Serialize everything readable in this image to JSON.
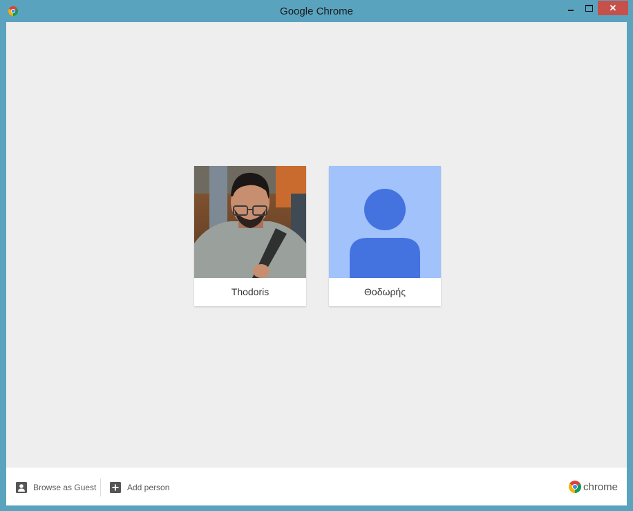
{
  "window": {
    "title": "Google Chrome",
    "close_glyph": "✕",
    "frame_color": "#5aa3bf",
    "close_color": "#c7504a"
  },
  "profiles": [
    {
      "name": "Thodoris",
      "avatar": "user-photo"
    },
    {
      "name": "Θοδωρής",
      "avatar": "default-person-avatar",
      "avatar_bg": "#a1c2fa",
      "avatar_fg": "#4473e0"
    }
  ],
  "footer": {
    "guest_label": "Browse as Guest",
    "guest_icon": "person-icon",
    "add_label": "Add person",
    "add_icon": "plus-icon",
    "brand_text": "chrome"
  }
}
